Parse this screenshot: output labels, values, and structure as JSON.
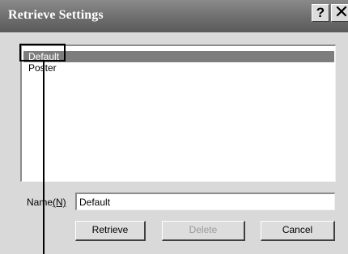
{
  "window": {
    "title": "Retrieve Settings",
    "help_label": "?",
    "close_label": "✕"
  },
  "settings_list": {
    "items": [
      {
        "label": "Default",
        "selected": true
      },
      {
        "label": "Poster",
        "selected": false
      }
    ]
  },
  "name_field": {
    "label_prefix": "Name",
    "label_accel": "(N)",
    "value": "Default"
  },
  "buttons": {
    "retrieve_label": "Retrieve",
    "delete_label": "Delete",
    "delete_enabled": false,
    "cancel_label": "Cancel"
  },
  "colors": {
    "title_bar": "#6e6e6e",
    "dialog_bg": "#d9d9d9",
    "selection": "#7d7d7d"
  }
}
